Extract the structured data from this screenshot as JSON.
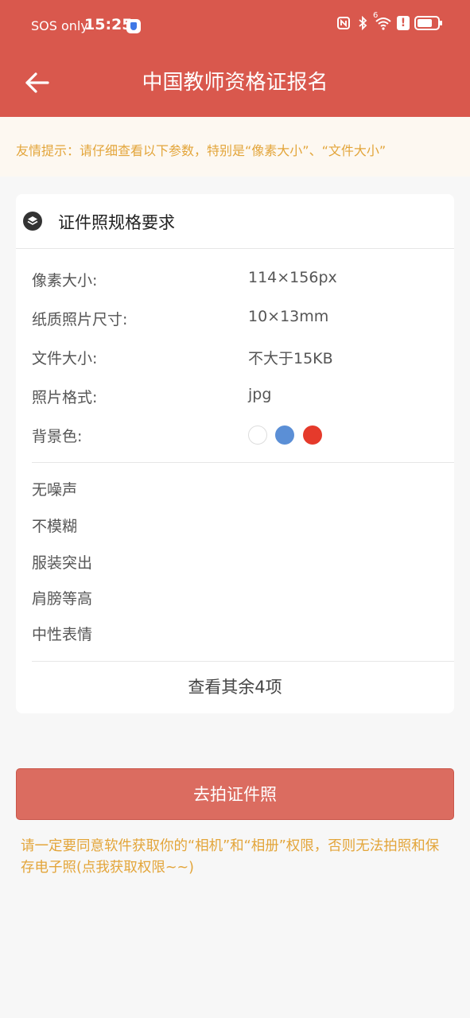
{
  "status_bar": {
    "carrier": "SOS only",
    "time": "15:25",
    "wifi_badge": "6"
  },
  "nav": {
    "title": "中国教师资格证报名"
  },
  "tip": {
    "text": "友情提示：请仔细查看以下参数，特别是“像素大小”、“文件大小”"
  },
  "card": {
    "title": "证件照规格要求",
    "specs": [
      {
        "label": "像素大小:",
        "value": "114×156px"
      },
      {
        "label": "纸质照片尺寸:",
        "value": "10×13mm"
      },
      {
        "label": "文件大小:",
        "value": "不大于15KB"
      },
      {
        "label": "照片格式:",
        "value": "jpg"
      },
      {
        "label": "背景色:",
        "value": ""
      }
    ],
    "background_colors": [
      "#ffffff",
      "#5b8fd6",
      "#e53a2b"
    ],
    "requirements": [
      "无噪声",
      "不模糊",
      "服装突出",
      "肩膀等高",
      "中性表情"
    ],
    "more_label": "查看其余4项"
  },
  "primary_button": {
    "label": "去拍证件照"
  },
  "notice": {
    "text": "请一定要同意软件获取你的“相机”和“相册”权限，否则无法拍照和保存电子照(点我获取权限~~)"
  },
  "colors": {
    "header": "#d9584d",
    "button": "#db6c60",
    "accent_text": "#e3a53a"
  }
}
